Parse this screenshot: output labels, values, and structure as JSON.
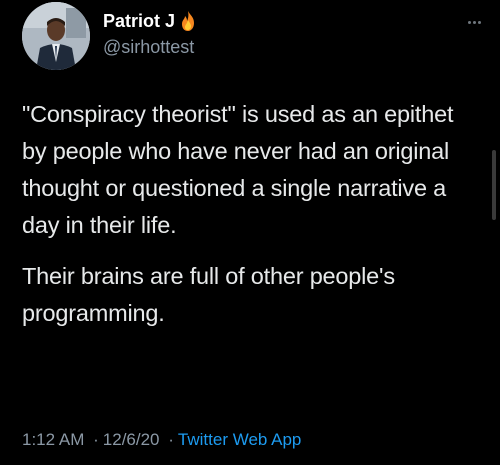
{
  "author": {
    "name": "Patriot J",
    "handle": "@sirhottest",
    "badge_icon": "fire-icon"
  },
  "tweet": {
    "paragraphs": [
      "\"Conspiracy theorist\" is used as an epithet by people who have never had an original thought or questioned a single narrative a day in their life.",
      "Their brains are full of other people's programming."
    ]
  },
  "meta": {
    "time": "1:12 AM",
    "separator": "·",
    "date": "12/6/20",
    "source": "Twitter Web App"
  },
  "colors": {
    "background": "#000000",
    "text": "#e7e9ea",
    "secondary_text": "#8b98a5",
    "link": "#1d9bf0"
  }
}
